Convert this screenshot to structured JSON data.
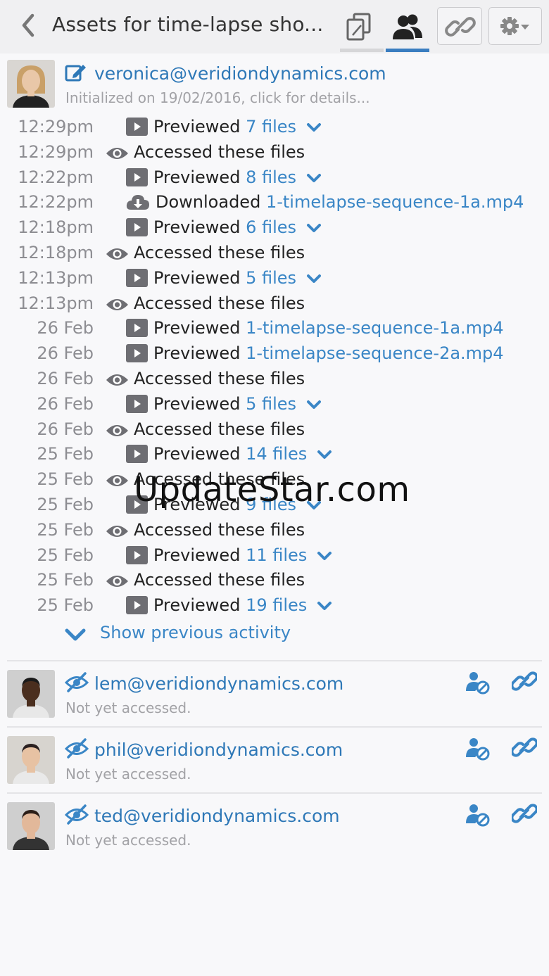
{
  "header": {
    "title": "Assets for time-lapse sho...",
    "tabs": [
      {
        "name": "files-tab",
        "icon": "copy-icon",
        "active": false
      },
      {
        "name": "people-tab",
        "icon": "users-icon",
        "active": true
      }
    ],
    "accent": "#3a7dc0"
  },
  "owner": {
    "email": "veronica@veridiondynamics.com",
    "subtitle": "Initialized on 19/02/2016, click for details..."
  },
  "activity": [
    {
      "time": "12:29pm",
      "icon": "play-icon",
      "action": "Previewed",
      "target": "7 files",
      "expandable": true
    },
    {
      "time": "12:29pm",
      "icon": "eye-icon",
      "action": "Accessed these files",
      "target": "",
      "expandable": false
    },
    {
      "time": "12:22pm",
      "icon": "play-icon",
      "action": "Previewed",
      "target": "8 files",
      "expandable": true
    },
    {
      "time": "12:22pm",
      "icon": "cloud-download-icon",
      "action": "Downloaded",
      "target": "1-timelapse-sequence-1a.mp4",
      "expandable": false
    },
    {
      "time": "12:18pm",
      "icon": "play-icon",
      "action": "Previewed",
      "target": "6 files",
      "expandable": true
    },
    {
      "time": "12:18pm",
      "icon": "eye-icon",
      "action": "Accessed these files",
      "target": "",
      "expandable": false
    },
    {
      "time": "12:13pm",
      "icon": "play-icon",
      "action": "Previewed",
      "target": "5 files",
      "expandable": true
    },
    {
      "time": "12:13pm",
      "icon": "eye-icon",
      "action": "Accessed these files",
      "target": "",
      "expandable": false
    },
    {
      "time": "26 Feb",
      "icon": "play-icon",
      "action": "Previewed",
      "target": "1-timelapse-sequence-1a.mp4",
      "expandable": false
    },
    {
      "time": "26 Feb",
      "icon": "play-icon",
      "action": "Previewed",
      "target": "1-timelapse-sequence-2a.mp4",
      "expandable": false
    },
    {
      "time": "26 Feb",
      "icon": "eye-icon",
      "action": "Accessed these files",
      "target": "",
      "expandable": false
    },
    {
      "time": "26 Feb",
      "icon": "play-icon",
      "action": "Previewed",
      "target": "5 files",
      "expandable": true
    },
    {
      "time": "26 Feb",
      "icon": "eye-icon",
      "action": "Accessed these files",
      "target": "",
      "expandable": false
    },
    {
      "time": "25 Feb",
      "icon": "play-icon",
      "action": "Previewed",
      "target": "14 files",
      "expandable": true
    },
    {
      "time": "25 Feb",
      "icon": "eye-icon",
      "action": "Accessed these files",
      "target": "",
      "expandable": false
    },
    {
      "time": "25 Feb",
      "icon": "play-icon",
      "action": "Previewed",
      "target": "9 files",
      "expandable": true
    },
    {
      "time": "25 Feb",
      "icon": "eye-icon",
      "action": "Accessed these files",
      "target": "",
      "expandable": false
    },
    {
      "time": "25 Feb",
      "icon": "play-icon",
      "action": "Previewed",
      "target": "11 files",
      "expandable": true
    },
    {
      "time": "25 Feb",
      "icon": "eye-icon",
      "action": "Accessed these files",
      "target": "",
      "expandable": false
    },
    {
      "time": "25 Feb",
      "icon": "play-icon",
      "action": "Previewed",
      "target": "19 files",
      "expandable": true
    }
  ],
  "show_previous": "Show previous activity",
  "watermark": "UpdateStar.com",
  "recipients": [
    {
      "email": "lem@veridiondynamics.com",
      "status": "Not yet accessed."
    },
    {
      "email": "phil@veridiondynamics.com",
      "status": "Not yet accessed."
    },
    {
      "email": "ted@veridiondynamics.com",
      "status": "Not yet accessed."
    }
  ]
}
